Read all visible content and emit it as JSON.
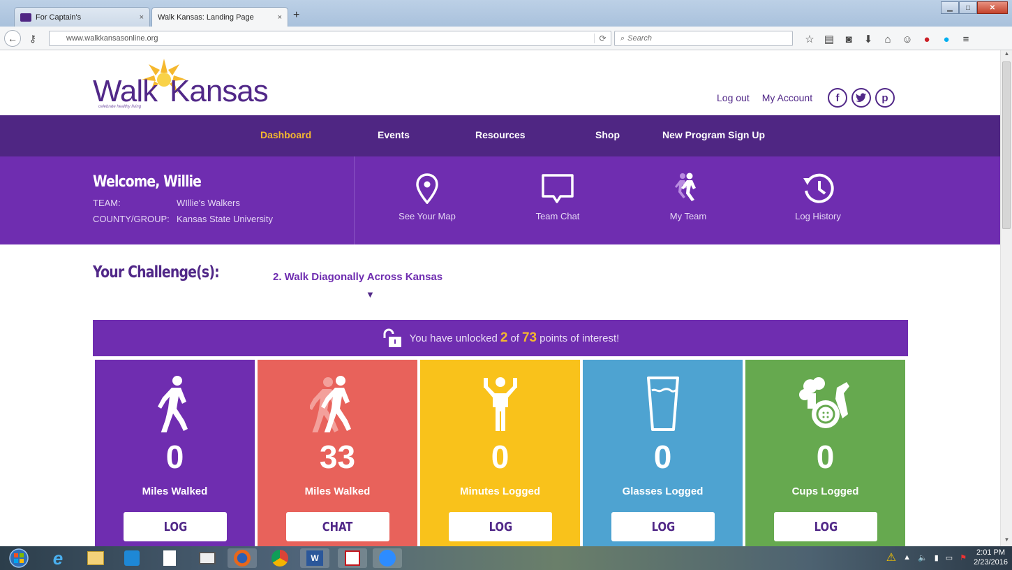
{
  "browser": {
    "tabs": [
      {
        "title": "For Captain's",
        "active": false
      },
      {
        "title": "Walk Kansas: Landing Page",
        "active": true
      }
    ],
    "new_tab": "+",
    "url": "www.walkkansasonline.org",
    "search_placeholder": "Search"
  },
  "site": {
    "logo_walk": "Walk",
    "logo_kansas": "Kansas",
    "logo_tagline": "celebrate healthy living",
    "toplinks": {
      "logout": "Log out",
      "account": "My Account"
    },
    "social": [
      "facebook-icon",
      "twitter-icon",
      "pinterest-icon"
    ],
    "nav": [
      {
        "label": "Dashboard",
        "active": true
      },
      {
        "label": "Events"
      },
      {
        "label": "Resources"
      },
      {
        "label": "Shop"
      },
      {
        "label": "New Program Sign Up"
      }
    ]
  },
  "welcome": {
    "greeting": "Welcome, Willie",
    "team_label": "TEAM:",
    "team_value": "WIllie's Walkers",
    "county_label": "COUNTY/GROUP:",
    "county_value": "Kansas State University",
    "actions": [
      {
        "label": "See Your Map",
        "icon": "map-pin-icon"
      },
      {
        "label": "Team Chat",
        "icon": "chat-bubble-icon"
      },
      {
        "label": "My Team",
        "icon": "team-walkers-icon"
      },
      {
        "label": "Log History",
        "icon": "history-clock-icon"
      }
    ]
  },
  "challenge": {
    "label": "Your Challenge(s):",
    "selected": "2. Walk Diagonally Across Kansas",
    "caret": "▼"
  },
  "unlock": {
    "prefix": "You have unlocked",
    "unlocked": "2",
    "of": "of",
    "total": "73",
    "suffix": "points of interest!"
  },
  "cards": [
    {
      "value": "0",
      "label": "Miles Walked",
      "button": "LOG",
      "color": "#6f2db0",
      "icon": "walker-icon"
    },
    {
      "value": "33",
      "label": "Miles Walked",
      "button": "CHAT",
      "color": "#e8625b",
      "icon": "team-walkers-icon"
    },
    {
      "value": "0",
      "label": "Minutes Logged",
      "button": "LOG",
      "color": "#f9c21b",
      "icon": "weightlifter-icon"
    },
    {
      "value": "0",
      "label": "Glasses Logged",
      "button": "LOG",
      "color": "#4ea3d1",
      "icon": "water-glass-icon"
    },
    {
      "value": "0",
      "label": "Cups Logged",
      "button": "LOG",
      "color": "#66a94f",
      "icon": "fruit-veg-icon"
    }
  ],
  "taskbar": {
    "time": "2:01 PM",
    "date": "2/23/2016"
  }
}
